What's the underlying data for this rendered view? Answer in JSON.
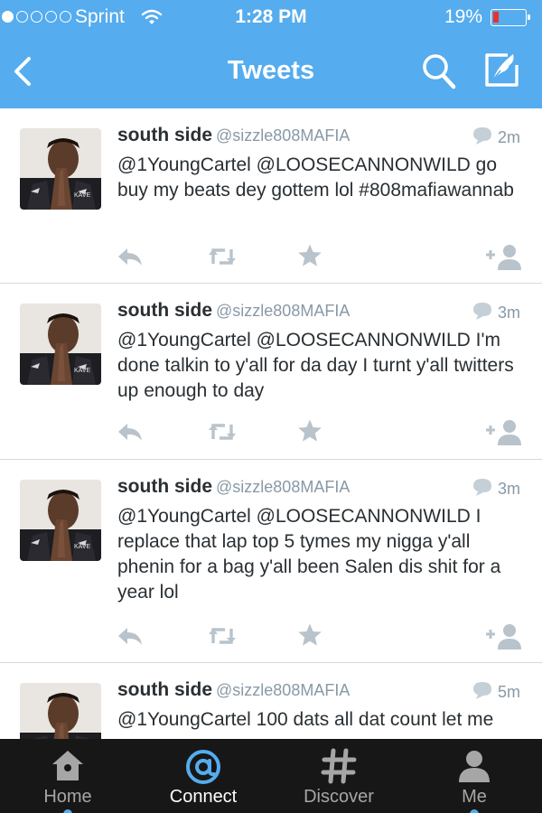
{
  "status_bar": {
    "carrier": "Sprint",
    "time": "1:28 PM",
    "battery": "19%",
    "battery_level": 0.19,
    "signal_bars_filled": 1,
    "signal_bars_total": 5
  },
  "nav": {
    "title": "Tweets",
    "back_icon": "chevron-left-icon",
    "search_icon": "search-icon",
    "compose_icon": "compose-icon"
  },
  "tweets": [
    {
      "name": "south side",
      "handle": "@sizzle808MAFIA",
      "time": "2m",
      "text": "@1YoungCartel @LOOSECANNONWILD go buy my beats dey gottem lol #808mafiawannab"
    },
    {
      "name": "south side",
      "handle": "@sizzle808MAFIA",
      "time": "3m",
      "text": "@1YoungCartel @LOOSECANNONWILD I'm done talkin to y'all for da day I turnt y'all twitters up enough to day"
    },
    {
      "name": "south side",
      "handle": "@sizzle808MAFIA",
      "time": "3m",
      "text": "@1YoungCartel @LOOSECANNONWILD I replace that lap top 5 tymes my nigga y'all phenin for a bag y'all been Salen dis shit for a year lol"
    },
    {
      "name": "south side",
      "handle": "@sizzle808MAFIA",
      "time": "5m",
      "text": "@1YoungCartel 100 dats all dat count let me"
    }
  ],
  "tabs": [
    {
      "label": "Home",
      "icon": "home-icon"
    },
    {
      "label": "Connect",
      "icon": "at-icon"
    },
    {
      "label": "Discover",
      "icon": "hashtag-icon"
    },
    {
      "label": "Me",
      "icon": "person-icon"
    }
  ],
  "colors": {
    "brand_blue": "#55acee",
    "tab_bar": "#171717",
    "handle_gray": "#8899a6",
    "action_gray": "#b8c3cc",
    "battery_red": "#e8322b"
  }
}
